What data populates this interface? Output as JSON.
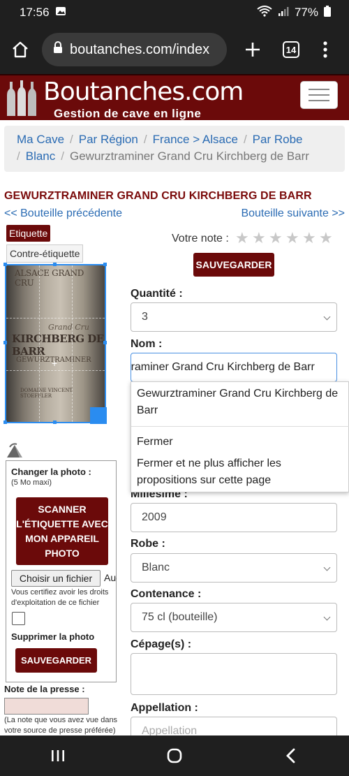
{
  "status_bar": {
    "time": "17:56",
    "battery": "77%"
  },
  "browser": {
    "url": "boutanches.com/index",
    "tab_count": "14"
  },
  "site": {
    "logo_title": "Boutanches.com",
    "logo_subtitle": "Gestion de cave en ligne"
  },
  "breadcrumb": [
    "Ma Cave",
    "Par Région",
    "France > Alsace",
    "Par Robe",
    "Blanc",
    "Gewurztraminer Grand Cru Kirchberg de Barr"
  ],
  "wine": {
    "title": "GEWURZTRAMINER GRAND CRU KIRCHBERG DE BARR",
    "prev_link": "<< Bouteille précédente",
    "next_link": "Bouteille suivante >>"
  },
  "photo_tabs": {
    "front": "Etiquette",
    "back": "Contre-étiquette"
  },
  "label_image": {
    "line1": "ALSACE GRAND CRU",
    "line2": "Grand Cru",
    "line3": "KIRCHBERG DE BARR",
    "line4": "GEWURZTRAMINER",
    "line5": "DOMAINE VINCENT STOEFFLER"
  },
  "photo_panel": {
    "title": "Changer la photo :",
    "hint": "(5 Mo maxi)",
    "scan_button": "SCANNER L'ÉTIQUETTE AVEC MON APPAREIL PHOTO",
    "file_button": "Choisir un fichier",
    "file_status": "Aucun fichier choisi",
    "certify": "Vous certifiez avoir les droits d'exploitation de ce fichier",
    "delete_label": "Supprimer la photo",
    "save_button": "SAUVEGARDER"
  },
  "press": {
    "label": "Note de la presse :",
    "hint": "(La note que vous avez vue dans votre source de presse préférée)"
  },
  "rating": {
    "label": "Votre note :",
    "stars_filled": 0,
    "stars_total": 6,
    "save_button": "SAUVEGARDER"
  },
  "form": {
    "quantity_label": "Quantité :",
    "quantity_value": "3",
    "name_label": "Nom :",
    "name_value": "Gewurztraminer Grand Cru Kirchberg de Barr",
    "millesime_label": "Millésime :",
    "millesime_value": "2009",
    "robe_label": "Robe :",
    "robe_value": "Blanc",
    "contenance_label": "Contenance :",
    "contenance_value": "75 cl (bouteille)",
    "cepage_label": "Cépage(s) :",
    "cepage_value": "",
    "appellation_label": "Appellation :",
    "appellation_placeholder": "Appellation"
  },
  "autocomplete": {
    "suggestion": "Gewurztraminer Grand Cru Kirchberg de Barr",
    "close": "Fermer",
    "close_forever": "Fermer et ne plus afficher les propositions sur cette page"
  },
  "colors": {
    "brand": "#6b0a0a",
    "link": "#2a6bb3",
    "focus": "#4a90e2"
  }
}
